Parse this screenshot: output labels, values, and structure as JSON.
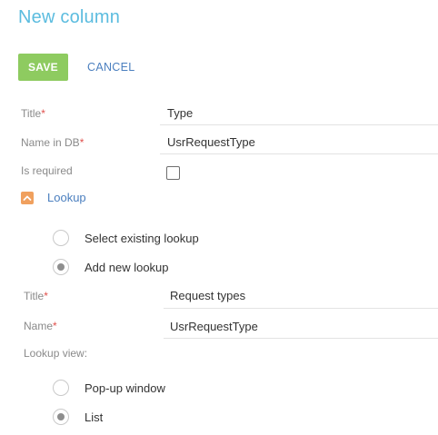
{
  "header": {
    "title": "New column"
  },
  "toolbar": {
    "save_label": "SAVE",
    "cancel_label": "CANCEL"
  },
  "fields": {
    "title": {
      "label": "Title",
      "required_mark": "*",
      "value": "Type"
    },
    "name_in_db": {
      "label": "Name in DB",
      "required_mark": "*",
      "value": "UsrRequestType"
    },
    "is_required": {
      "label": "Is required",
      "checked": false
    }
  },
  "lookup_group": {
    "label": "Lookup",
    "expanded": true,
    "options": [
      {
        "label": "Select existing lookup",
        "selected": false
      },
      {
        "label": "Add new lookup",
        "selected": true
      }
    ],
    "new_lookup": {
      "title": {
        "label": "Title",
        "required_mark": "*",
        "value": "Request types"
      },
      "name": {
        "label": "Name",
        "required_mark": "*",
        "value": "UsrRequestType"
      },
      "view_label": "Lookup view:",
      "view_options": [
        {
          "label": "Pop-up window",
          "selected": false
        },
        {
          "label": "List",
          "selected": true
        }
      ]
    }
  },
  "colors": {
    "title": "#5bbcdf",
    "save_button": "#8ecb60",
    "link": "#4b7fbf",
    "required": "#e0504c",
    "group_toggle": "#f0a05e"
  }
}
